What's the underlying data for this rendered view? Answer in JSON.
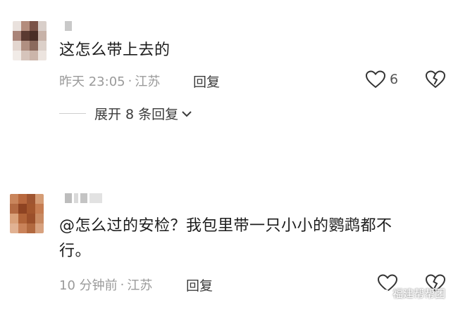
{
  "comments": [
    {
      "text": "这怎么带上去的",
      "time": "昨天 23:05",
      "location": "江苏",
      "reply_label": "回复",
      "likes": "6",
      "expand_label": "展开 8 条回复",
      "avatar_colors": [
        "#e9e1dd",
        "#b38c7c",
        "#7a5348",
        "#d9cfca",
        "#a98478",
        "#5b3a31",
        "#4a2e27",
        "#c7b2a8",
        "#e3d6cf",
        "#b08f81",
        "#8b6a5d",
        "#dcd0c9",
        "#f1ebe7",
        "#d6c4bb",
        "#cbb5aa",
        "#ece4df"
      ]
    },
    {
      "text_line1": "@怎么过的安检？我包里带一只小小的鹦鹉都不",
      "text_line2": "行。",
      "time": "10 分钟前",
      "location": "江苏",
      "reply_label": "回复",
      "avatar_colors": [
        "#c9855c",
        "#b8683e",
        "#9f5531",
        "#d59c75",
        "#b36a43",
        "#8e4322",
        "#a3562d",
        "#c67d52",
        "#d9a17a",
        "#b06338",
        "#9b4f2a",
        "#c98a62",
        "#e1b293",
        "#c98259",
        "#b2693f",
        "#d8a27f"
      ]
    }
  ],
  "watermark": "福建帮帮团",
  "colors": {
    "text": "#1c1c1c",
    "meta": "#9a9a9a"
  }
}
